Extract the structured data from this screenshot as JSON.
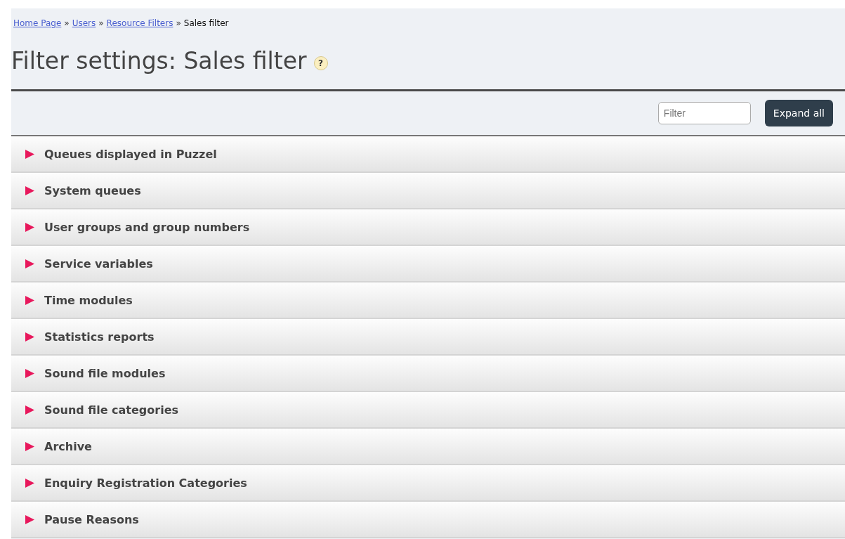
{
  "breadcrumb": {
    "links": [
      "Home Page",
      "Users",
      "Resource Filters"
    ],
    "separator": "»",
    "current": "Sales filter"
  },
  "title": "Filter settings: Sales filter",
  "help_icon": "?",
  "toolbar": {
    "filter": {
      "placeholder": "Filter"
    },
    "expand_button": "Expand all"
  },
  "sections": [
    {
      "label": "Queues displayed in Puzzel",
      "expanded": false
    },
    {
      "label": "System queues",
      "expanded": false
    },
    {
      "label": "User groups and group numbers",
      "expanded": false
    },
    {
      "label": "Service variables",
      "expanded": false
    },
    {
      "label": "Time modules",
      "expanded": false
    },
    {
      "label": "Statistics reports",
      "expanded": false
    },
    {
      "label": "Sound file modules",
      "expanded": false
    },
    {
      "label": "Sound file categories",
      "expanded": false
    },
    {
      "label": "Archive",
      "expanded": false
    },
    {
      "label": "Enquiry Registration Categories",
      "expanded": false
    },
    {
      "label": "Pause Reasons",
      "expanded": false
    }
  ]
}
